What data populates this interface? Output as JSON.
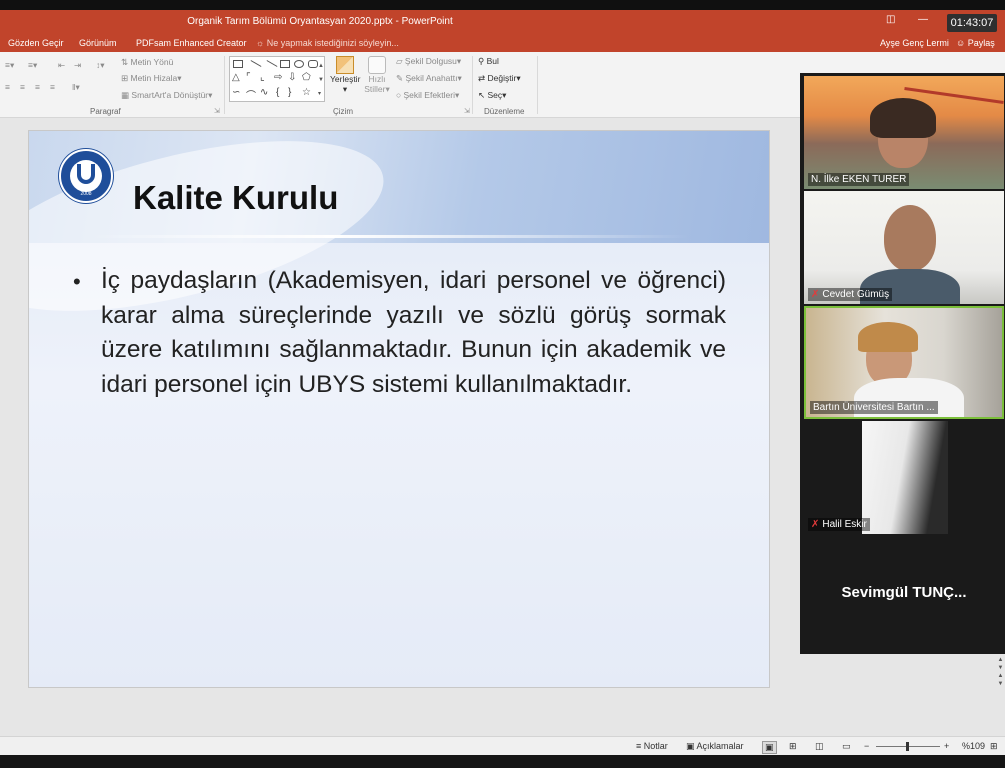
{
  "window": {
    "title": "Organik Tarım Bölümü Oryantasyan 2020.pptx - PowerPoint",
    "clock": "01:43:07"
  },
  "tabs": {
    "items": [
      "Gözden Geçir",
      "Görünüm",
      "PDFsam Enhanced Creator"
    ],
    "tell_me": "Ne yapmak istediğinizi söyleyin...",
    "user": "Ayşe Genç Lermi",
    "share": "Paylaş"
  },
  "ribbon": {
    "paragraph_group": "Paragraf",
    "text_direction": "Metin Yönü",
    "align_text": "Metin Hizala",
    "smartart": "SmartArt'a Dönüştür",
    "drawing_group": "Çizim",
    "arrange": "Yerleştir",
    "quick_styles_1": "Hızlı",
    "quick_styles_2": "Stiller",
    "shape_fill": "Şekil Dolgusu",
    "shape_outline": "Şekil Anahattı",
    "shape_effects": "Şekil Efektleri",
    "editing_group": "Düzenleme",
    "find": "Bul",
    "replace": "Değiştir",
    "select": "Seç"
  },
  "slide": {
    "title": "Kalite Kurulu",
    "body": "İç paydaşların (Akademisyen, idari personel ve öğrenci) karar alma süreçlerinde yazılı ve sözlü görüş sormak üzere katılımını sağlanmaktadır. Bunun için akademik ve idari personel için UBYS sistemi kullanılmaktadır.",
    "logo_year": "2008"
  },
  "statusbar": {
    "notes": "Notlar",
    "comments": "Açıklamalar",
    "zoom": "%109"
  },
  "participants": [
    {
      "name": "N. İlke EKEN TURER",
      "muted": false,
      "active": false
    },
    {
      "name": "Cevdet Gümüş",
      "muted": true,
      "active": false
    },
    {
      "name": "Bartın Üniversitesi Bartın ...",
      "muted": false,
      "active": true
    },
    {
      "name": "Halil Eskir",
      "muted": true,
      "active": false
    },
    {
      "name": "Sevimgül  TUNÇ...",
      "muted": false,
      "active": false
    }
  ],
  "colors": {
    "accent": "#c1442b",
    "active_speaker": "#7bbf3a",
    "muted": "#e23b3b"
  }
}
